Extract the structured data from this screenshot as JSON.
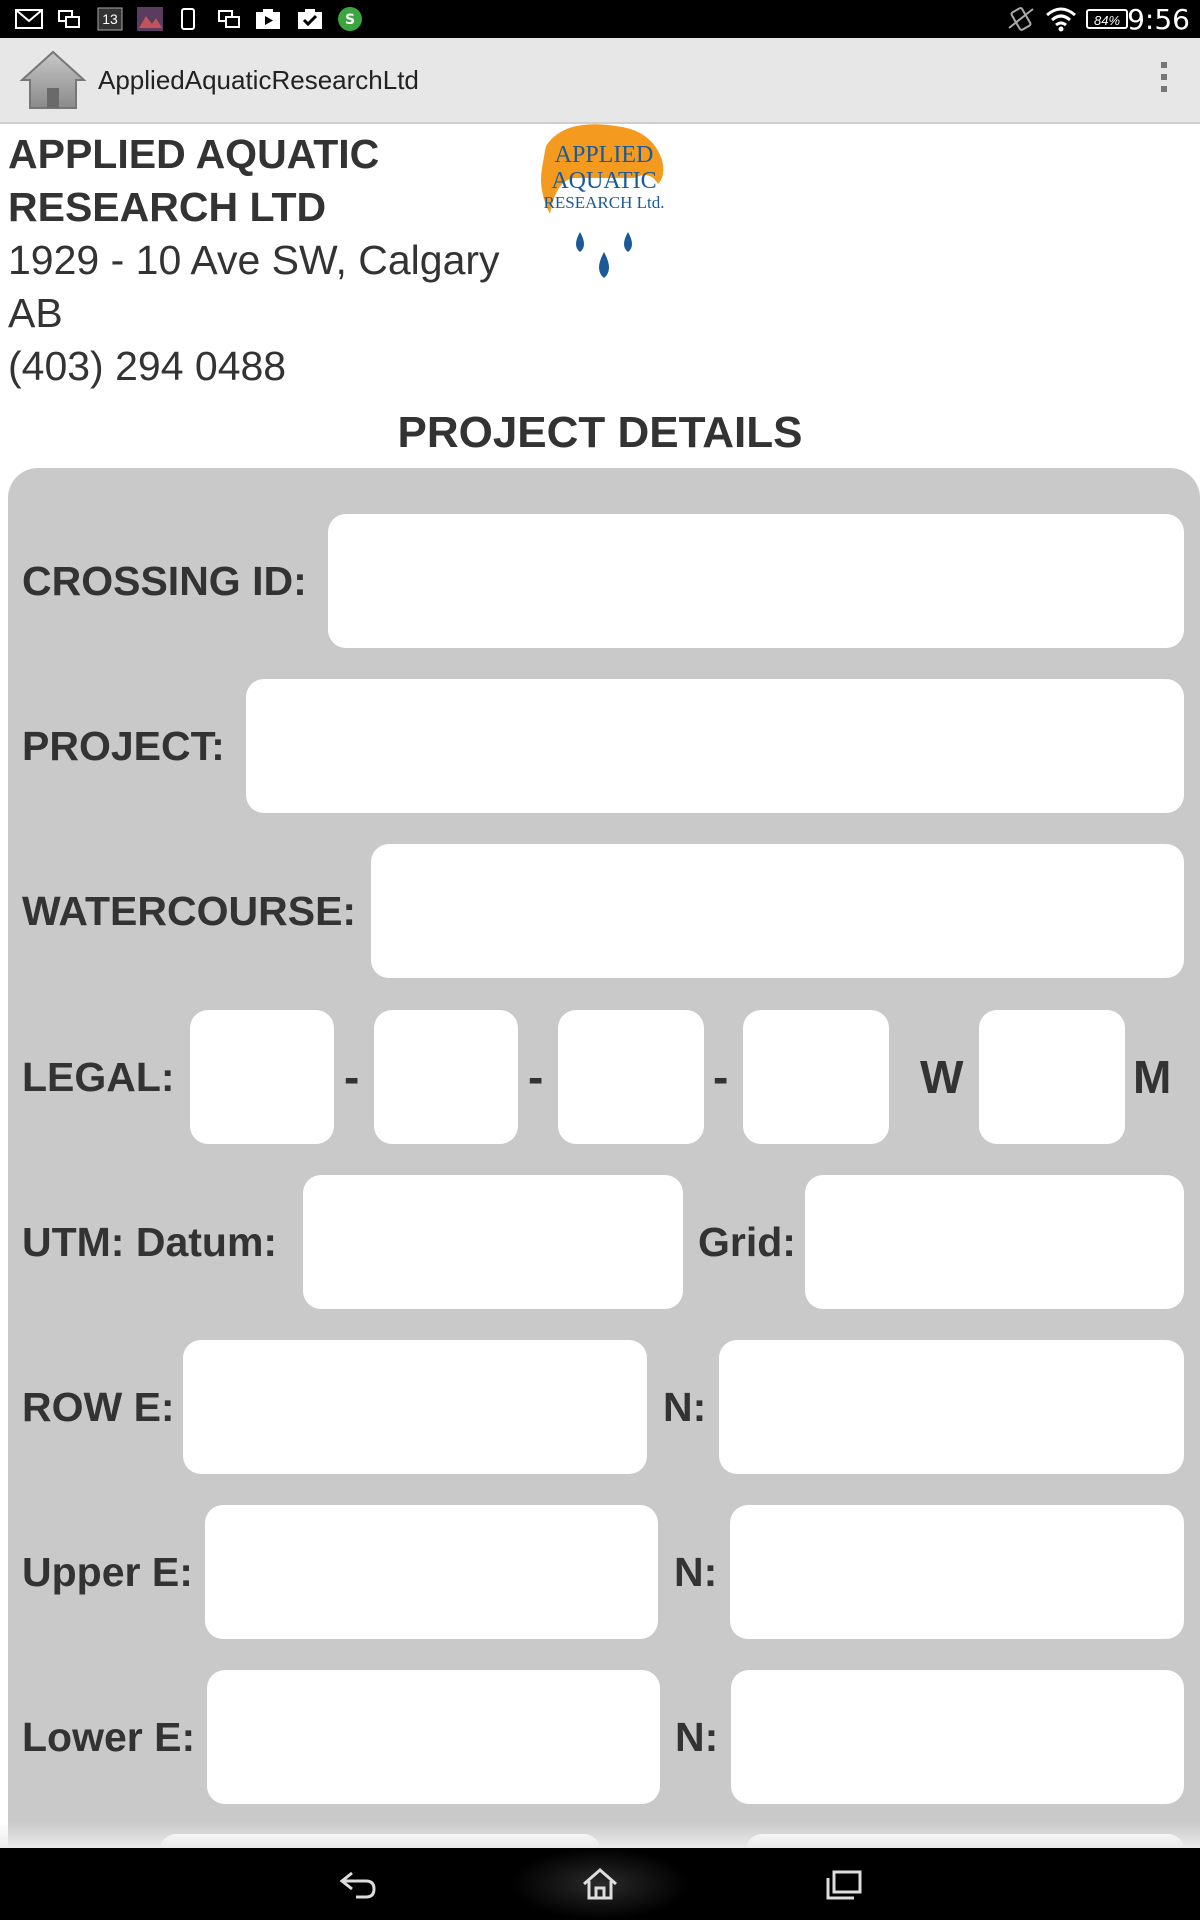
{
  "status_bar": {
    "time": "9:56",
    "battery": "84%",
    "left_icons": [
      "gmail-icon",
      "screens-icon",
      "calendar-13-icon",
      "photo-icon",
      "phone-icon",
      "screens-icon",
      "youtube-icon",
      "task-icon",
      "skype-icon"
    ],
    "calendar_day": "13",
    "right_icons": [
      "vibrate-icon",
      "wifi-icon",
      "battery-icon"
    ]
  },
  "action_bar": {
    "title": "AppliedAquaticResearchLtd",
    "home_icon": "home-icon",
    "overflow_icon": "overflow-menu-icon"
  },
  "company": {
    "name_line1": "APPLIED AQUATIC",
    "name_line2": "RESEARCH LTD",
    "address_line1": "1929 - 10 Ave SW, Calgary",
    "address_line2": "AB",
    "phone": "(403) 294 0488",
    "logo": {
      "line1": "APPLIED",
      "line2": "AQUATIC",
      "line3": "RESEARCH Ltd.",
      "orange": "#f39a1f",
      "blue": "#1b5a99"
    }
  },
  "section_title": "PROJECT DETAILS",
  "form": {
    "crossing_id": {
      "label": "CROSSING ID:",
      "value": ""
    },
    "project": {
      "label": "PROJECT:",
      "value": ""
    },
    "watercourse": {
      "label": "WATERCOURSE:",
      "value": ""
    },
    "legal": {
      "label": "LEGAL:",
      "sep1": "-",
      "sep2": "-",
      "sep3": "-",
      "w": "W",
      "m": "M",
      "values": [
        "",
        "",
        "",
        "",
        ""
      ]
    },
    "utm": {
      "label": "UTM: Datum:",
      "grid_label": "Grid:",
      "datum_value": "",
      "grid_value": ""
    },
    "row": {
      "label": "ROW E:",
      "n_label": "N:",
      "e_value": "",
      "n_value": ""
    },
    "upper": {
      "label": "Upper E:",
      "n_label": "N:",
      "e_value": "",
      "n_value": ""
    },
    "lower": {
      "label": "Lower E:",
      "n_label": "N:",
      "e_value": "",
      "n_value": ""
    }
  },
  "nav_bar": {
    "back_icon": "back-icon",
    "home_icon": "nav-home-icon",
    "recents_icon": "recents-icon"
  },
  "colors": {
    "panel": "#c9c9c9",
    "action_bar": "#e7e7e7",
    "text": "#333333"
  }
}
